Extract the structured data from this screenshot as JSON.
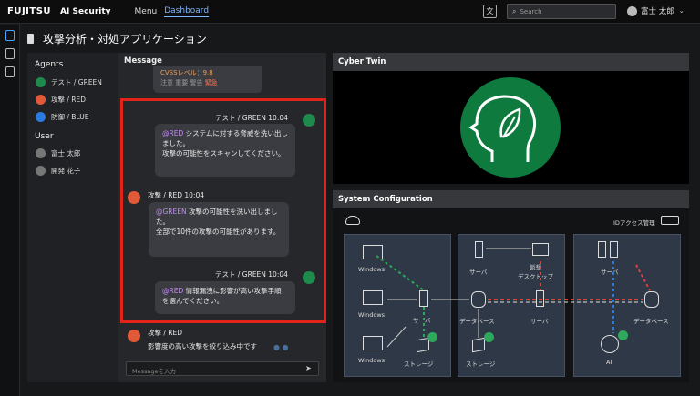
{
  "topbar": {
    "logo": "FUJITSU",
    "app_name": "AI Security",
    "menu_label": "Menu",
    "dashboard_label": "Dashboard",
    "search_placeholder": "Search",
    "user_name": "富士 太郎"
  },
  "page": {
    "title": "攻撃分析・対処アプリケーション"
  },
  "left": {
    "agents_title": "Agents",
    "agents": [
      {
        "label": "テスト / GREEN",
        "color": "#1e8a4c"
      },
      {
        "label": "攻撃 / RED",
        "color": "#e05a3a"
      },
      {
        "label": "防御 / BLUE",
        "color": "#2a7be0"
      }
    ],
    "user_title": "User",
    "users": [
      {
        "label": "富士 太郎"
      },
      {
        "label": "開発 花子"
      }
    ]
  },
  "message": {
    "title": "Message",
    "cut_top": {
      "line1": "CVSSレベル：9.8",
      "line2_prefix": "注意 重要 警告",
      "line2_hot": "緊急"
    },
    "items": [
      {
        "meta": "テスト / GREEN 10:04",
        "mention": "@RED",
        "text": " システムに対する脅威を洗い出しました。",
        "text2": "攻撃の可能性をスキャンしてください。"
      },
      {
        "meta": "攻撃 / RED 10:04",
        "mention": "@GREEN",
        "text": " 攻撃の可能性を洗い出しました。",
        "text2": "全部で10件の攻撃の可能性があります。"
      },
      {
        "meta": "テスト / GREEN 10:04",
        "mention": "@RED",
        "text": " 情報漏洩に影響が高い攻撃手順を選んでください。",
        "text2": ""
      },
      {
        "meta": "攻撃 / RED",
        "text": "影響度の高い攻撃を絞り込み中です"
      }
    ],
    "input_placeholder": "Messageを入力"
  },
  "cyber": {
    "title": "Cyber Twin"
  },
  "system": {
    "title": "System Configuration",
    "id_label": "IDアクセス管理",
    "labels": {
      "windows": "Windows",
      "server": "サーバ",
      "storage": "ストレージ",
      "database": "データベース",
      "vdesk": "仮想\nデスクトップ",
      "ai": "AI"
    }
  }
}
